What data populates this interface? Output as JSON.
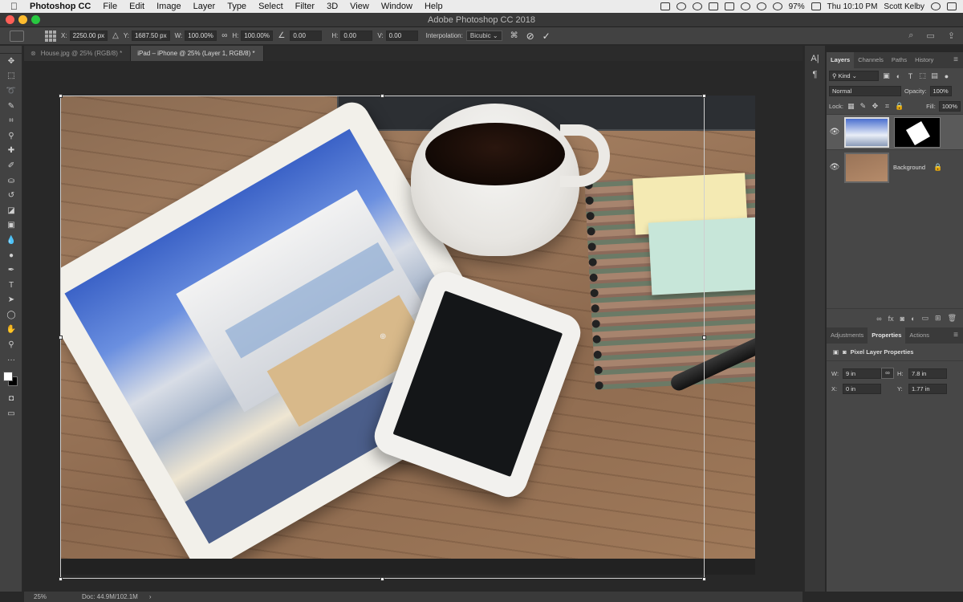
{
  "menubar": {
    "app": "Photoshop CC",
    "items": [
      "File",
      "Edit",
      "Image",
      "Layer",
      "Type",
      "Select",
      "Filter",
      "3D",
      "View",
      "Window",
      "Help"
    ],
    "battery": "97%",
    "clock": "Thu 10:10 PM",
    "user": "Scott Kelby"
  },
  "window": {
    "title": "Adobe Photoshop CC 2018"
  },
  "options": {
    "x_label": "X:",
    "x": "2250.00 px",
    "y_label": "Y:",
    "y": "1687.50 px",
    "w_label": "W:",
    "w": "100.00%",
    "h_label": "H:",
    "h": "100.00%",
    "angle": "0.00",
    "hskew_label": "H:",
    "hskew": "0.00",
    "vskew_label": "V:",
    "vskew": "0.00",
    "interp_label": "Interpolation:",
    "interp": "Bicubic"
  },
  "tabs": [
    {
      "label": "House.jpg @ 25% (RGB/8) *",
      "active": false
    },
    {
      "label": "iPad – iPhone @ 25% (Layer 1, RGB/8) *",
      "active": true
    }
  ],
  "status": {
    "zoom": "25%",
    "doc": "Doc: 44.9M/102.1M"
  },
  "layers_panel": {
    "tabs": [
      "Layers",
      "Channels",
      "Paths",
      "History"
    ],
    "kind": "Kind",
    "blend": "Normal",
    "opacity_label": "Opacity:",
    "opacity": "100%",
    "lock_label": "Lock:",
    "fill_label": "Fill:",
    "fill": "100%",
    "layers": [
      {
        "name": "",
        "selected": true
      },
      {
        "name": "Background",
        "selected": false
      }
    ]
  },
  "props_panel": {
    "tabs": [
      "Adjustments",
      "Properties",
      "Actions"
    ],
    "title": "Pixel Layer Properties",
    "w_label": "W:",
    "w": "9 in",
    "h_label": "H:",
    "h": "7.8 in",
    "x_label": "X:",
    "x": "0 in",
    "y_label": "Y:",
    "y": "1.77 in"
  }
}
